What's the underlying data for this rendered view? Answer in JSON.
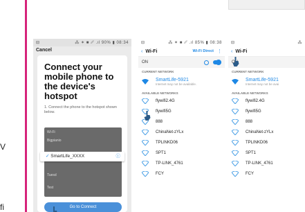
{
  "left_fragments": [
    "V",
    "fi"
  ],
  "accent_color": "#d6237a",
  "phone1": {
    "status_left": "⊟",
    "status_right": "⁂ ✶ ■ ␥ .ıl 90% ▮ 08:34",
    "cancel": "Cancel",
    "heading": "Connect your mobile phone to the device's hotspot",
    "description": "1. Connect the phone to the hotspot shown below.",
    "mock_rows": [
      "Wi-Fi",
      "Bigpianio",
      "",
      "",
      "Tuesd",
      "",
      "Test"
    ],
    "highlight_ssid": "SmartLife_XXXX",
    "button": "Go to Connect"
  },
  "phone2": {
    "status_left": "⊟",
    "status_right": "⁂ ✶ ■ ␥ .ıl 85% ▮ 08:38",
    "title": "Wi-Fi",
    "direct": "Wi-Fi Direct",
    "on_label": "ON",
    "current_header": "CURRENT NETWORK",
    "current_name": "SmartLife-5921",
    "current_sub": "Internet may not be available.",
    "available_header": "AVAILABLE NETWORKS",
    "networks": [
      "flywifi2.4G",
      "flywifi5G",
      "888",
      "ChinaNet-zYLx",
      "TPLINKD06",
      "SPT1",
      "TP-LINK_4761",
      "FCY"
    ]
  },
  "phone3": {
    "status_left": "⊟",
    "title": "Wi-Fi",
    "on_label": "ON",
    "current_header": "CURRENT NETWORK",
    "current_name": "SmartLife-5921",
    "current_sub": "Internet may not be avai",
    "available_header": "AVAILABLE NETWORKS",
    "networks": [
      "flywifi2.4G",
      "flywifi5G",
      "888",
      "ChinaNet-zYLx",
      "TPLINKD06",
      "SPT1",
      "TP-LINK_4761",
      "FCY"
    ]
  }
}
